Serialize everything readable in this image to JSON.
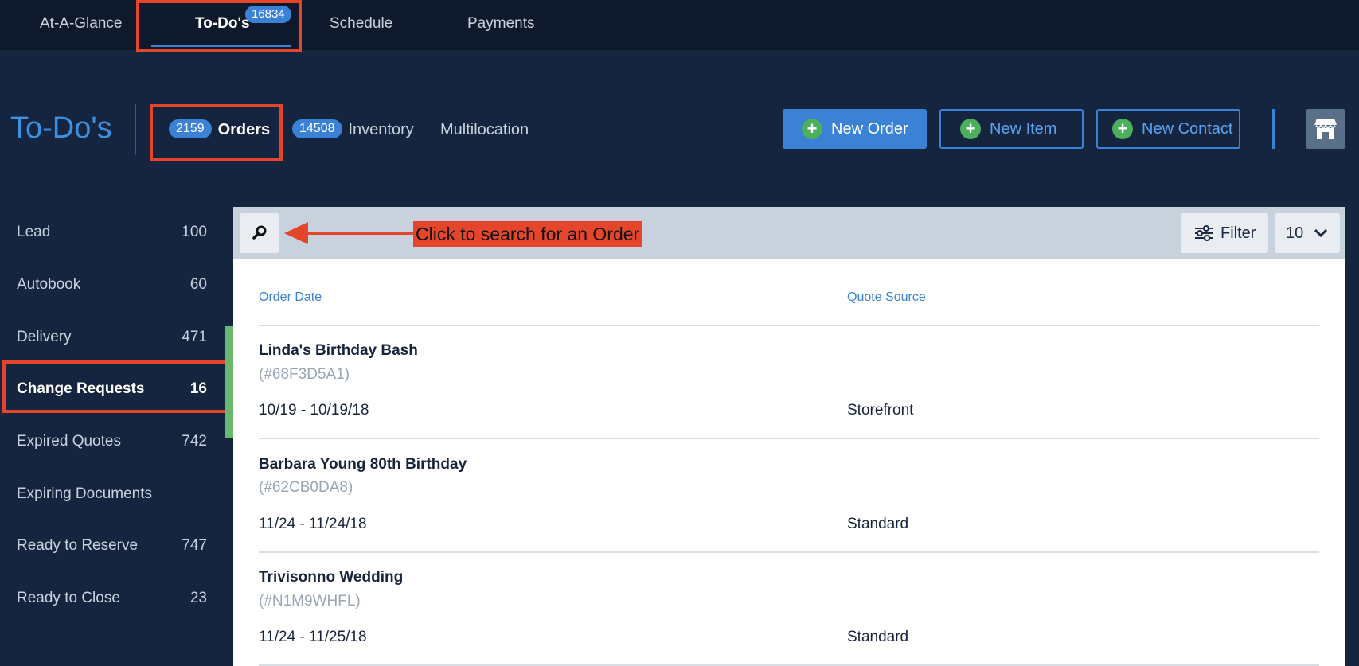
{
  "top_nav": {
    "tabs": [
      {
        "label": "At-A-Glance"
      },
      {
        "label": "To-Do's",
        "badge": "16834",
        "active": true
      },
      {
        "label": "Schedule"
      },
      {
        "label": "Payments"
      }
    ]
  },
  "header": {
    "title": "To-Do's",
    "subtabs": [
      {
        "label": "Orders",
        "count": "2159",
        "active": true
      },
      {
        "label": "Inventory",
        "count": "14508"
      },
      {
        "label": "Multilocation"
      }
    ],
    "buttons": {
      "new_order": "New Order",
      "new_item": "New Item",
      "new_contact": "New Contact"
    },
    "store_icon": "storefront-icon"
  },
  "sidebar": {
    "items": [
      {
        "label": "Lead",
        "count": "100"
      },
      {
        "label": "Autobook",
        "count": "60"
      },
      {
        "label": "Delivery",
        "count": "471"
      },
      {
        "label": "Change Requests",
        "count": "16",
        "active": true
      },
      {
        "label": "Expired Quotes",
        "count": "742"
      },
      {
        "label": "Expiring Documents",
        "count": ""
      },
      {
        "label": "Ready to Reserve",
        "count": "747"
      },
      {
        "label": "Ready to Close",
        "count": "23"
      }
    ]
  },
  "toolbar": {
    "search_icon": "search-icon",
    "callout": "Click to search for an Order",
    "filter_label": "Filter",
    "per_page": "10"
  },
  "table": {
    "columns": [
      "Order Date",
      "Quote Source"
    ],
    "rows": [
      {
        "name": "Linda's Birthday Bash",
        "id": "(#68F3D5A1)",
        "date": "10/19 - 10/19/18",
        "source": "Storefront"
      },
      {
        "name": "Barbara Young 80th Birthday",
        "id": "(#62CB0DA8)",
        "date": "11/24 - 11/24/18",
        "source": "Standard"
      },
      {
        "name": "Trivisonno Wedding",
        "id": "(#N1M9WHFL)",
        "date": "11/24 - 11/25/18",
        "source": "Standard"
      }
    ]
  },
  "colors": {
    "accent": "#3b82d6",
    "callout": "#e4452b",
    "background": "#16253f",
    "topbar": "#0e1a2c"
  }
}
